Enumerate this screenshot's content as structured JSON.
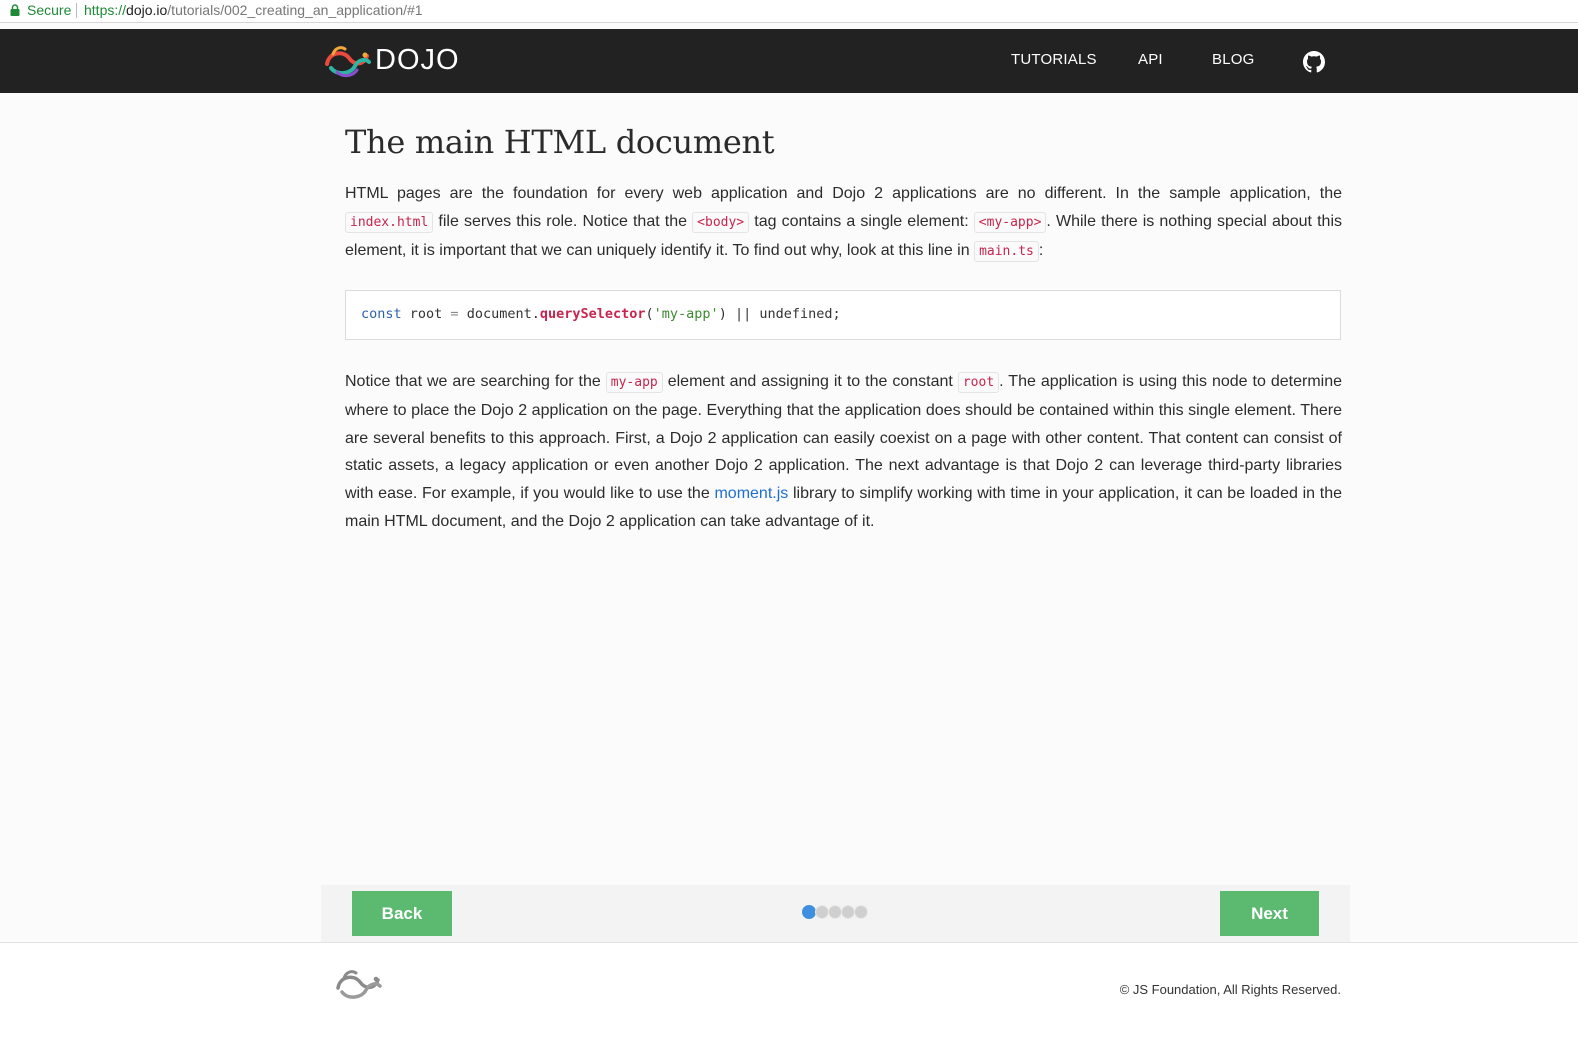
{
  "browser": {
    "secure_label": "Secure",
    "url_scheme": "https://",
    "url_host": "dojo.io",
    "url_path": "/tutorials/002_creating_an_application/#1"
  },
  "header": {
    "logo_text": "DOJO",
    "nav": [
      "TUTORIALS",
      "API",
      "BLOG"
    ]
  },
  "page": {
    "title": "The main HTML document",
    "p1": {
      "t1": "HTML pages are the foundation for every web application and Dojo 2 applications are no different. In the sample application, the ",
      "c1": "index.html",
      "t2": " file serves this role. Notice that the ",
      "c2": "<body>",
      "t3": " tag contains a single element: ",
      "c3": "<my-app>",
      "t4": ". While there is nothing special about this element, it is important that we can uniquely identify it. To find out why, look at this line in ",
      "c4": "main.ts",
      "t5": ":"
    },
    "code": {
      "kw": "const",
      "root": " root ",
      "eq": "=",
      "doc": " document.",
      "fn": "querySelector",
      "open": "(",
      "str": "'my-app'",
      "rest": ") || undefined;"
    },
    "p2": {
      "t1": "Notice that we are searching for the ",
      "c1": "my-app",
      "t2": " element and assigning it to the constant ",
      "c2": "root",
      "t3": ". The application is using this node to determine where to place the Dojo 2 application on the page. Everything that the application does should be contained within this single element. There are several benefits to this approach. First, a Dojo 2 application can easily coexist on a page with other content. That content can consist of static assets, a legacy application or even another Dojo 2 application. The next advantage is that Dojo 2 can leverage third-party libraries with ease. For example, if you would like to use the ",
      "link": "moment.js",
      "t4": " library to simplify working with time in your application, it can be loaded in the main HTML document, and the Dojo 2 application can take advantage of it."
    }
  },
  "pager": {
    "back_label": "Back",
    "next_label": "Next",
    "total_steps": 5,
    "current_step": 1
  },
  "footer": {
    "copyright": "© JS Foundation, All Rights Reserved."
  },
  "colors": {
    "navbar": "#222222",
    "button": "#5cb970",
    "active_dot": "#3f8fe0",
    "code_accent": "#c7254e",
    "link": "#1f6fd1"
  }
}
